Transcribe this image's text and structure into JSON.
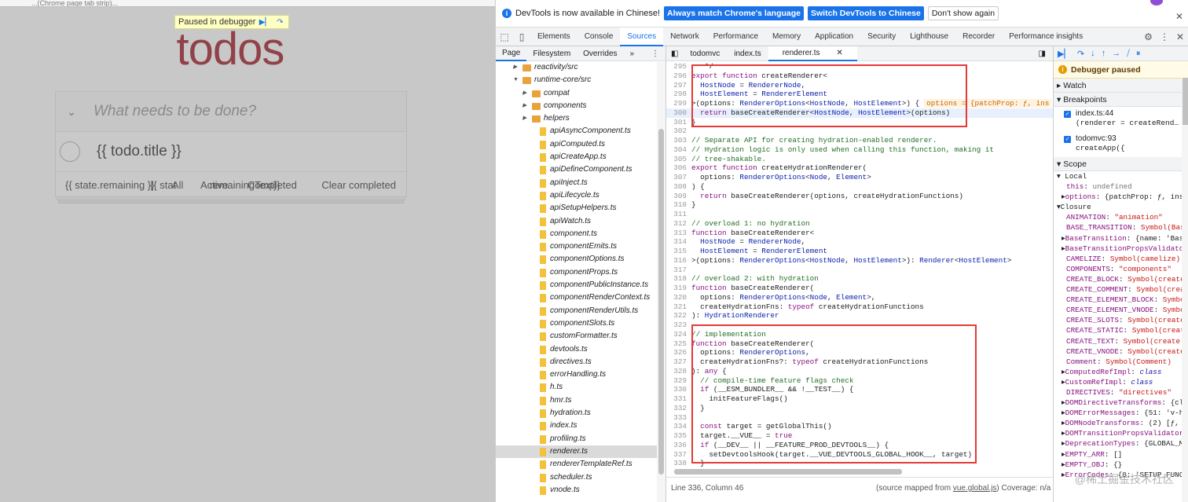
{
  "browser": {
    "top_strip": "...(Chrome page tab strip)..."
  },
  "page": {
    "debugger_banner": "Paused in debugger",
    "title": "todos",
    "new_todo_placeholder": "What needs to be done?",
    "todo_item": "{{ todo.title }}",
    "footer": {
      "remaining": "{{ state.remaining }}",
      "overlap1": "{{ stat",
      "all": "All",
      "remaining_text": "remainingText}}",
      "active": "Active",
      "completed": "Completed",
      "clear": "Clear completed"
    }
  },
  "devtools": {
    "infobar": {
      "message": "DevTools is now available in Chinese!",
      "btn_match": "Always match Chrome's language",
      "btn_switch": "Switch DevTools to Chinese",
      "btn_dismiss": "Don't show again"
    },
    "tabs": [
      "Elements",
      "Console",
      "Sources",
      "Network",
      "Performance",
      "Memory",
      "Application",
      "Security",
      "Lighthouse",
      "Recorder",
      "Performance insights"
    ],
    "active_tab": "Sources",
    "navigator": {
      "tabs": [
        "Page",
        "Filesystem",
        "Overrides",
        "»"
      ],
      "items": [
        {
          "type": "folder",
          "name": "reactivity/src",
          "indent": 1,
          "open": false
        },
        {
          "type": "folder",
          "name": "runtime-core/src",
          "indent": 1,
          "open": true
        },
        {
          "type": "folder",
          "name": "compat",
          "indent": 2,
          "open": false
        },
        {
          "type": "folder",
          "name": "components",
          "indent": 2,
          "open": false
        },
        {
          "type": "folder",
          "name": "helpers",
          "indent": 2,
          "open": false
        },
        {
          "type": "file",
          "name": "apiAsyncComponent.ts"
        },
        {
          "type": "file",
          "name": "apiComputed.ts"
        },
        {
          "type": "file",
          "name": "apiCreateApp.ts"
        },
        {
          "type": "file",
          "name": "apiDefineComponent.ts"
        },
        {
          "type": "file",
          "name": "apiInject.ts"
        },
        {
          "type": "file",
          "name": "apiLifecycle.ts"
        },
        {
          "type": "file",
          "name": "apiSetupHelpers.ts"
        },
        {
          "type": "file",
          "name": "apiWatch.ts"
        },
        {
          "type": "file",
          "name": "component.ts"
        },
        {
          "type": "file",
          "name": "componentEmits.ts"
        },
        {
          "type": "file",
          "name": "componentOptions.ts"
        },
        {
          "type": "file",
          "name": "componentProps.ts"
        },
        {
          "type": "file",
          "name": "componentPublicInstance.ts"
        },
        {
          "type": "file",
          "name": "componentRenderContext.ts"
        },
        {
          "type": "file",
          "name": "componentRenderUtils.ts"
        },
        {
          "type": "file",
          "name": "componentSlots.ts"
        },
        {
          "type": "file",
          "name": "customFormatter.ts"
        },
        {
          "type": "file",
          "name": "devtools.ts"
        },
        {
          "type": "file",
          "name": "directives.ts"
        },
        {
          "type": "file",
          "name": "errorHandling.ts"
        },
        {
          "type": "file",
          "name": "h.ts"
        },
        {
          "type": "file",
          "name": "hmr.ts"
        },
        {
          "type": "file",
          "name": "hydration.ts"
        },
        {
          "type": "file",
          "name": "index.ts"
        },
        {
          "type": "file",
          "name": "profiling.ts"
        },
        {
          "type": "file",
          "name": "renderer.ts",
          "selected": true
        },
        {
          "type": "file",
          "name": "rendererTemplateRef.ts"
        },
        {
          "type": "file",
          "name": "scheduler.ts"
        },
        {
          "type": "file",
          "name": "vnode.ts"
        }
      ]
    },
    "editor": {
      "tabs": [
        "todomvc",
        "index.ts",
        "renderer.ts"
      ],
      "active_tab": "renderer.ts",
      "lines": [
        {
          "n": "295",
          "t": "   */"
        },
        {
          "n": "296",
          "t": "export function createRenderer<"
        },
        {
          "n": "297",
          "t": "  HostNode = RendererNode,"
        },
        {
          "n": "298",
          "t": "  HostElement = RendererElement"
        },
        {
          "n": "299",
          "t": ">(options: RendererOptions<HostNode, HostElement>) {"
        },
        {
          "n": "300",
          "t": "  return baseCreateRenderer<HostNode, HostElement>(options)"
        },
        {
          "n": "301",
          "t": "}"
        },
        {
          "n": "302",
          "t": ""
        },
        {
          "n": "303",
          "t": "// Separate API for creating hydration-enabled renderer."
        },
        {
          "n": "304",
          "t": "// Hydration logic is only used when calling this function, making it"
        },
        {
          "n": "305",
          "t": "// tree-shakable."
        },
        {
          "n": "306",
          "t": "export function createHydrationRenderer("
        },
        {
          "n": "307",
          "t": "  options: RendererOptions<Node, Element>"
        },
        {
          "n": "308",
          "t": ") {"
        },
        {
          "n": "309",
          "t": "  return baseCreateRenderer(options, createHydrationFunctions)"
        },
        {
          "n": "310",
          "t": "}"
        },
        {
          "n": "311",
          "t": ""
        },
        {
          "n": "312",
          "t": "// overload 1: no hydration"
        },
        {
          "n": "313",
          "t": "function baseCreateRenderer<"
        },
        {
          "n": "314",
          "t": "  HostNode = RendererNode,"
        },
        {
          "n": "315",
          "t": "  HostElement = RendererElement"
        },
        {
          "n": "316",
          "t": ">(options: RendererOptions<HostNode, HostElement>): Renderer<HostElement>"
        },
        {
          "n": "317",
          "t": ""
        },
        {
          "n": "318",
          "t": "// overload 2: with hydration"
        },
        {
          "n": "319",
          "t": "function baseCreateRenderer("
        },
        {
          "n": "320",
          "t": "  options: RendererOptions<Node, Element>,"
        },
        {
          "n": "321",
          "t": "  createHydrationFns: typeof createHydrationFunctions"
        },
        {
          "n": "322",
          "t": "): HydrationRenderer"
        },
        {
          "n": "323",
          "t": ""
        },
        {
          "n": "324",
          "t": "// implementation"
        },
        {
          "n": "325",
          "t": "function baseCreateRenderer("
        },
        {
          "n": "326",
          "t": "  options: RendererOptions,"
        },
        {
          "n": "327",
          "t": "  createHydrationFns?: typeof createHydrationFunctions"
        },
        {
          "n": "328",
          "t": "): any {"
        },
        {
          "n": "329",
          "t": "  // compile-time feature flags check"
        },
        {
          "n": "330",
          "t": "  if (__ESM_BUNDLER__ && !__TEST__) {"
        },
        {
          "n": "331",
          "t": "    initFeatureFlags()"
        },
        {
          "n": "332",
          "t": "  }"
        },
        {
          "n": "333",
          "t": ""
        },
        {
          "n": "334",
          "t": "  const target = getGlobalThis()"
        },
        {
          "n": "335",
          "t": "  target.__VUE__ = true"
        },
        {
          "n": "336",
          "t": "  if (__DEV__ || __FEATURE_PROD_DEVTOOLS__) {"
        },
        {
          "n": "337",
          "t": "    setDevtoolsHook(target.__VUE_DEVTOOLS_GLOBAL_HOOK__, target)"
        },
        {
          "n": "338",
          "t": "  }"
        }
      ],
      "inline_value": "options = {patchProp: ƒ, ins",
      "status_left": "Line 336, Column 46",
      "status_right_prefix": "(source mapped from ",
      "status_right_link": "vue.global.js",
      "status_right_suffix": ") Coverage: n/a"
    },
    "debugger": {
      "paused_label": "Debugger paused",
      "watch": "Watch",
      "breakpoints": "Breakpoints",
      "bp1_file": "index.ts:44",
      "bp1_code": "(renderer = createRend…",
      "bp2_file": "todomvc:93",
      "bp2_code": "createApp({",
      "scope": "Scope",
      "local": "Local",
      "scope_rows": [
        {
          "k": "this",
          "v": "undefined",
          "c": "g",
          "i": 2
        },
        {
          "k": "options",
          "v": "{patchProp: ƒ, inser",
          "c": "d",
          "i": 1,
          "tri": true
        },
        {
          "k": "Closure",
          "v": "",
          "c": "h",
          "i": 0,
          "tri": true,
          "open": true
        },
        {
          "k": "ANIMATION",
          "v": "\"animation\"",
          "c": "s",
          "i": 2
        },
        {
          "k": "BASE_TRANSITION",
          "v": "Symbol(Bas",
          "c": "s",
          "i": 2
        },
        {
          "k": "BaseTransition",
          "v": "{name: 'Bas",
          "c": "d",
          "i": 1,
          "tri": true
        },
        {
          "k": "BaseTransitionPropsValidato",
          "v": "",
          "c": "d",
          "i": 1,
          "tri": true
        },
        {
          "k": "CAMELIZE",
          "v": "Symbol(camelize)",
          "c": "s",
          "i": 2
        },
        {
          "k": "COMPONENTS",
          "v": "\"components\"",
          "c": "s",
          "i": 2
        },
        {
          "k": "CREATE_BLOCK",
          "v": "Symbol(create",
          "c": "s",
          "i": 2
        },
        {
          "k": "CREATE_COMMENT",
          "v": "Symbol(crea",
          "c": "s",
          "i": 2
        },
        {
          "k": "CREATE_ELEMENT_BLOCK",
          "v": "Symbo",
          "c": "s",
          "i": 2
        },
        {
          "k": "CREATE_ELEMENT_VNODE",
          "v": "Symbo",
          "c": "s",
          "i": 2
        },
        {
          "k": "CREATE_SLOTS",
          "v": "Symbol(create",
          "c": "s",
          "i": 2
        },
        {
          "k": "CREATE_STATIC",
          "v": "Symbol(creat",
          "c": "s",
          "i": 2
        },
        {
          "k": "CREATE_TEXT",
          "v": "Symbol(create",
          "c": "s",
          "i": 2
        },
        {
          "k": "CREATE_VNODE",
          "v": "Symbol(create",
          "c": "s",
          "i": 2
        },
        {
          "k": "Comment",
          "v": "Symbol(Comment)",
          "c": "s",
          "i": 2
        },
        {
          "k": "ComputedRefImpl",
          "v": "class",
          "c": "f",
          "i": 1,
          "tri": true
        },
        {
          "k": "CustomRefImpl",
          "v": "class",
          "c": "f",
          "i": 1,
          "tri": true
        },
        {
          "k": "DIRECTIVES",
          "v": "\"directives\"",
          "c": "s",
          "i": 2
        },
        {
          "k": "DOMDirectiveTransforms",
          "v": "{cl",
          "c": "d",
          "i": 1,
          "tri": true
        },
        {
          "k": "DOMErrorMessages",
          "v": "{51: 'v-h",
          "c": "d",
          "i": 1,
          "tri": true
        },
        {
          "k": "DOMNodeTransforms",
          "v": "(2) [ƒ,",
          "c": "d",
          "i": 1,
          "tri": true
        },
        {
          "k": "DOMTransitionPropsValidator",
          "v": "",
          "c": "d",
          "i": 1,
          "tri": true
        },
        {
          "k": "DeprecationTypes",
          "v": "{GLOBAL_M",
          "c": "d",
          "i": 1,
          "tri": true
        },
        {
          "k": "EMPTY_ARR",
          "v": "[]",
          "c": "d",
          "i": 1,
          "tri": true
        },
        {
          "k": "EMPTY_OBJ",
          "v": "{}",
          "c": "d",
          "i": 1,
          "tri": true
        },
        {
          "k": "ErrorCodes",
          "v": "{0: 'SETUP_FUNC",
          "c": "d",
          "i": 1,
          "tri": true
        }
      ]
    },
    "watermark": "@稀土掘金技术社区"
  }
}
